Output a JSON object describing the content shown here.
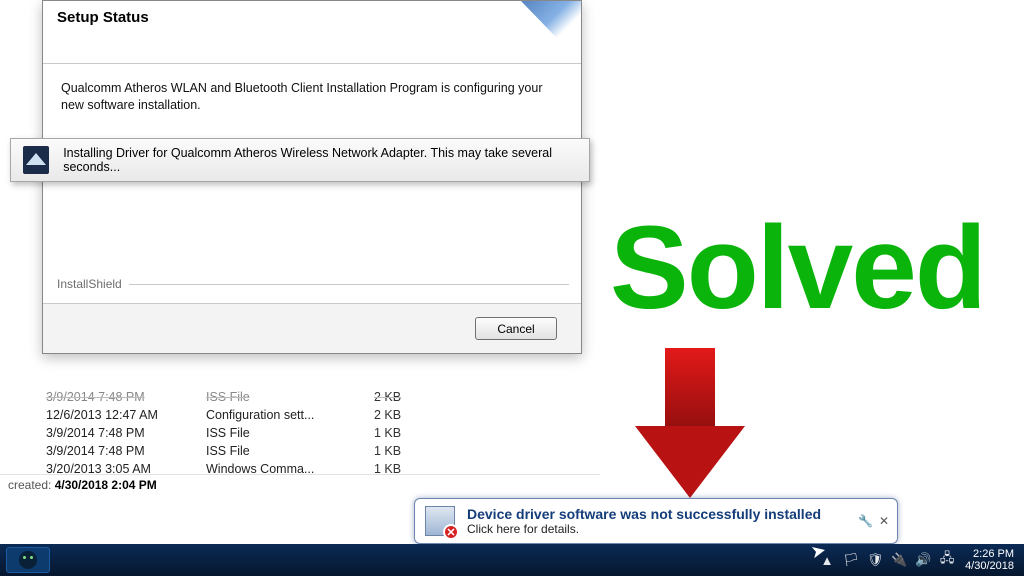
{
  "dialog": {
    "title": "Setup Status",
    "body_text": "Qualcomm Atheros WLAN and Bluetooth Client Installation Program is configuring your new software installation.",
    "installshield_label": "InstallShield",
    "cancel_label": "Cancel"
  },
  "progress_popup": {
    "text": "Installing Driver for Qualcomm Atheros Wireless Network Adapter. This may take several seconds..."
  },
  "filelist": {
    "rows": [
      {
        "date": "3/9/2014 7:48 PM",
        "type": "ISS File",
        "size": "2 KB",
        "cut": true
      },
      {
        "date": "12/6/2013 12:47 AM",
        "type": "Configuration sett...",
        "size": "2 KB",
        "cut": false
      },
      {
        "date": "3/9/2014 7:48 PM",
        "type": "ISS File",
        "size": "1 KB",
        "cut": false
      },
      {
        "date": "3/9/2014 7:48 PM",
        "type": "ISS File",
        "size": "1 KB",
        "cut": false
      },
      {
        "date": "3/20/2013 3:05 AM",
        "type": "Windows Comma...",
        "size": "1 KB",
        "cut": false
      }
    ]
  },
  "statusbar": {
    "label": "created:",
    "value": "4/30/2018 2:04 PM"
  },
  "overlay": {
    "solved_text": "Solved"
  },
  "balloon": {
    "title": "Device driver software was not successfully installed",
    "subtitle": "Click here for details.",
    "wrench": "🔧",
    "close": "✕"
  },
  "taskbar": {
    "tray_icons": [
      "▲",
      "🏳",
      "🛡",
      "🔌",
      "🔊",
      "🖧"
    ],
    "clock_time": "2:26 PM",
    "clock_date": "4/30/2018"
  }
}
